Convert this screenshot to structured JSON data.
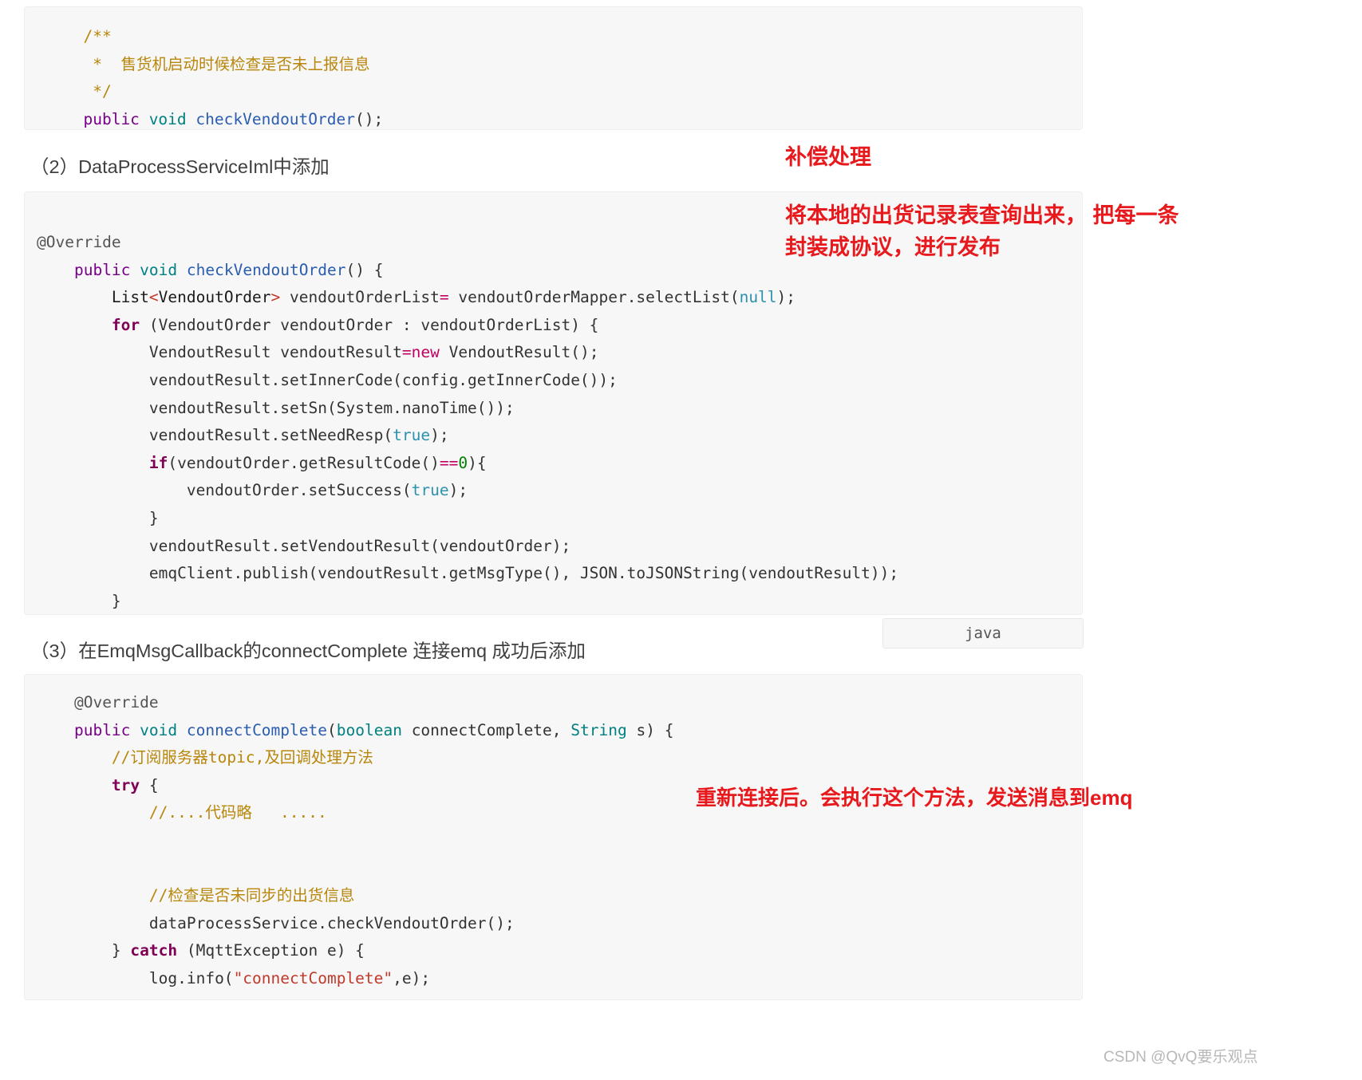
{
  "blocks": {
    "code1": {
      "lines": [
        "  /**",
        "   *  售货机启动时候检查是否未上报信息",
        "   */",
        "  public void checkVendoutOrder();"
      ]
    },
    "code2": {
      "lines": [
        "@Override",
        "    public void checkVendoutOrder() {",
        "        List<VendoutOrder> vendoutOrderList= vendoutOrderMapper.selectList(null);",
        "        for (VendoutOrder vendoutOrder : vendoutOrderList) {",
        "            VendoutResult vendoutResult=new VendoutResult();",
        "            vendoutResult.setInnerCode(config.getInnerCode());",
        "            vendoutResult.setSn(System.nanoTime());",
        "            vendoutResult.setNeedResp(true);",
        "            if(vendoutOrder.getResultCode()==0){",
        "                vendoutOrder.setSuccess(true);",
        "            }",
        "            vendoutResult.setVendoutResult(vendoutOrder);",
        "            emqClient.publish(vendoutResult.getMsgType(), JSON.toJSONString(vendoutResult));",
        "        }",
        "    }"
      ]
    },
    "code3": {
      "lines": [
        "    @Override",
        "    public void connectComplete(boolean connectComplete, String s) {",
        "        //订阅服务器topic,及回调处理方法",
        "        try {",
        "            //....代码略   .....",
        "",
        "",
        "            //检查是否未同步的出货信息",
        "            dataProcessService.checkVendoutOrder();",
        "        } catch (MqttException e) {",
        "            log.info(\"connectComplete\",e);",
        "        }"
      ]
    }
  },
  "headings": {
    "step2": "（2）DataProcessServiceIml中添加",
    "step3": "（3）在EmqMsgCallback的connectComplete 连接emq 成功后添加"
  },
  "annotations": {
    "compensation": "补偿处理",
    "query_line1": "将本地的出货记录表查询出来， 把每一条",
    "query_line2": "封装成协议，进行发布",
    "reconnect": "重新连接后。会执行这个方法，发送消息到emq"
  },
  "lang_tag": {
    "label": "java"
  },
  "watermark": {
    "text": "CSDN @QvQ要乐观点"
  },
  "colors": {
    "annotation_red": "#e8191c",
    "code_bg": "#f7f7f7",
    "page_bg": "#ffffff",
    "watermark_gray": "#b7b7b7"
  }
}
